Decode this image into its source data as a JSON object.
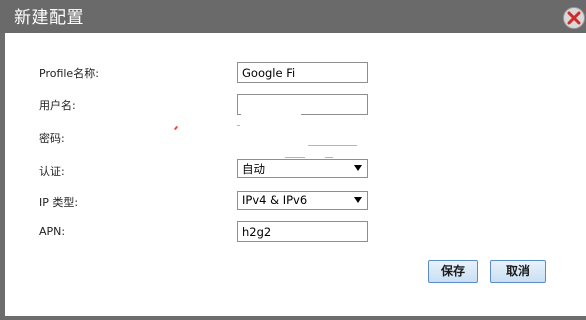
{
  "dialog": {
    "title": "新建配置"
  },
  "form": {
    "profile_name": {
      "label": "Profile名称:",
      "value": "Google Fi"
    },
    "username": {
      "label": "用户名:",
      "value": ""
    },
    "password": {
      "label": "密码:",
      "value": ""
    },
    "auth": {
      "label": "认证:",
      "selected": "自动"
    },
    "ip_type": {
      "label": "IP 类型:",
      "selected": "IPv4 & IPv6"
    },
    "apn": {
      "label": "APN:",
      "value": "h2g2"
    }
  },
  "buttons": {
    "save_label": "保存",
    "cancel_label": "取消"
  },
  "colors": {
    "titlebar": "#6a6a6a",
    "close_x": "#d22a2a",
    "button_border": "#5a8dc7"
  }
}
